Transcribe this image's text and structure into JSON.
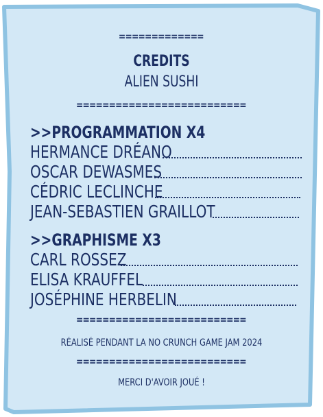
{
  "colors": {
    "paper_fill": "#d3e8f6",
    "paper_border": "#8fc3e2",
    "text": "#1c2f63"
  },
  "separators": {
    "short": "=============",
    "long": "=========================="
  },
  "header": {
    "title": "CREDITS",
    "subtitle": "ALIEN SUSHI"
  },
  "programming": {
    "heading": ">>PROGRAMMATION X4",
    "members": [
      "HERMANCE DRÉANO",
      "OSCAR DEWASMES",
      "CÉDRIC LECLINCHE",
      "JEAN-SEBASTIEN GRAILLOT"
    ]
  },
  "graphics": {
    "heading": ">>GRAPHISME X3",
    "members": [
      "CARL ROSSEZ",
      "ELISA KRAUFFEL",
      "JOSÉPHINE HERBELIN"
    ]
  },
  "footer": {
    "jam_note": "RÉALISÉ PENDANT LA NO CRUNCH GAME JAM 2024",
    "thanks": "MERCI D'AVOIR JOUÉ !"
  }
}
